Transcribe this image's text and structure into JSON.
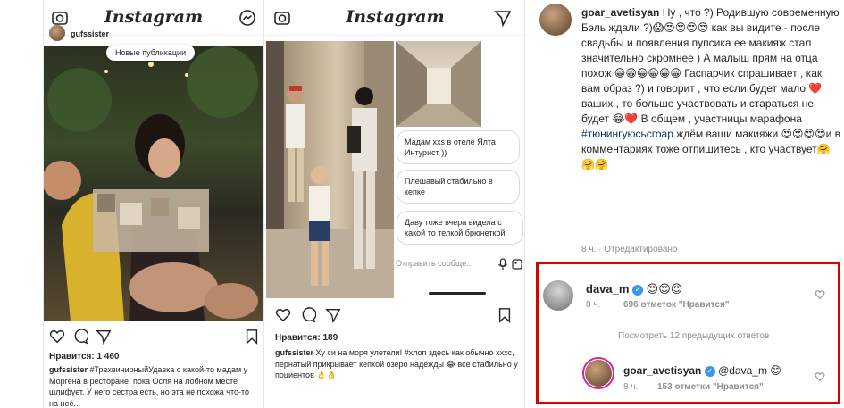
{
  "panel1": {
    "logo": "Instagram",
    "username": "gufssister",
    "new_posts_pill": "Новые публикации",
    "likes": "Нравится: 1 460",
    "caption_user": "gufssister",
    "caption_text": "#ТрехвинирныйУдавка с какой-то мадам у Моргена в ресторане, пока Осля на лобном месте шлифует. У него сестра есть, но эта не похожа что-то на неё..."
  },
  "panel2": {
    "logo": "Instagram",
    "bubbles": [
      "Мадам xxs в отеле Ялта Интурист ))",
      "Плешавый стабильно в кепке",
      "Даву тоже вчера видела с какой то телкой брюнеткой"
    ],
    "reply_placeholder": "Отправить сообще...",
    "likes": "Нравится: 189",
    "caption_user": "gufssister",
    "caption_text": "Ху си на моря улетели! #хлоп здесь как обычно хххс, пернатый прикрывает кепкой озеро надежды 😂 все стабильно у поциентов 👌👌"
  },
  "panel3": {
    "author": "goar_avetisyan",
    "comment_text": "Ну , что ?) Родившую современную Бэль ждали ?)😱😍😍😍😍 как вы видите - после свадьбы и появления пупсика ее макияж стал значительно скромнее ) А малыш прям на отца похож 😁😁😁😁😁😁 Гаспарчик спрашивает , как вам образ ?) и говорит , что если будет мало ❤️ ваших , то больше участвовать и стараться не будет 😂❤️ В общем , участницы марафона",
    "hashtag": "#тюнингуюсьсгоар",
    "comment_text_after": "ждём ваши макияжи 😍😍😍😍и в комментариях тоже отпишитесь , кто участвует🤗🤗🤗",
    "meta": "8 ч. · Отредактировано",
    "reply1_user": "dava_m",
    "reply1_text": "😍😍😍",
    "reply1_time": "8 ч.",
    "reply1_likes": "696 отметок \"Нравится\"",
    "view_prev": "Посмотреть 12 предыдущих ответов",
    "reply2_user": "goar_avetisyan",
    "reply2_text": "@dava_m 😊",
    "reply2_time": "8 ч.",
    "reply2_likes": "153 отметки \"Нравится\"",
    "highlight_color": "#d90000"
  }
}
